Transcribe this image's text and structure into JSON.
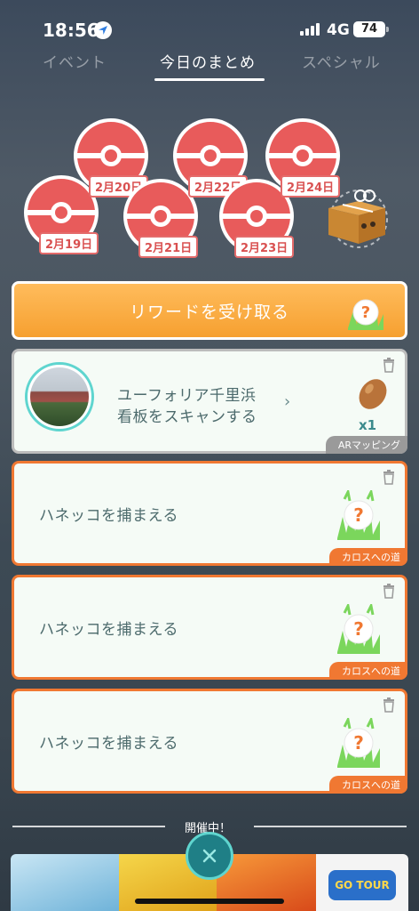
{
  "status_bar": {
    "time": "18:56",
    "network": "4G",
    "battery": "74"
  },
  "tabs": [
    {
      "label": "イベント",
      "active": false
    },
    {
      "label": "今日のまとめ",
      "active": true
    },
    {
      "label": "スペシャル",
      "active": false
    }
  ],
  "stamps": [
    "2月19日",
    "2月20日",
    "2月21日",
    "2月22日",
    "2月23日",
    "2月24日"
  ],
  "reward_button": {
    "label": "リワードを受け取る"
  },
  "quests": [
    {
      "text_line1": "ユーフォリア千里浜",
      "text_line2": "看板をスキャンする",
      "reward_count": "x1",
      "tag": "ARマッピング"
    },
    {
      "text": "ハネッコを捕まえる",
      "tag": "カロスへの道"
    },
    {
      "text": "ハネッコを捕まえる",
      "tag": "カロスへの道"
    },
    {
      "text": "ハネッコを捕まえる",
      "tag": "カロスへの道"
    }
  ],
  "ongoing": {
    "label": "開催中！",
    "logo_text": "GO TOUR"
  },
  "colors": {
    "accent_orange": "#f07832",
    "teal": "#5fd5cf",
    "stamp_red": "#e85b5b"
  }
}
